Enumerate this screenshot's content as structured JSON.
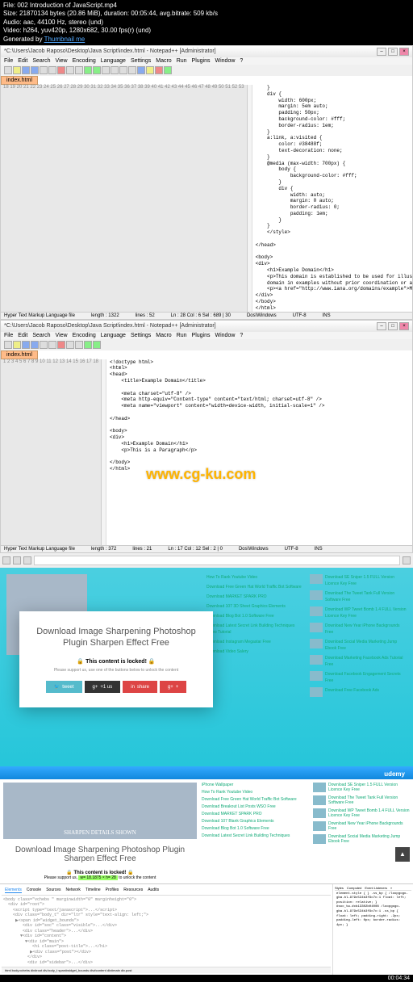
{
  "meta": {
    "file": "File: 002 Introduction of JavaScript.mp4",
    "size": "Size: 21870134 bytes (20.86 MiB), duration: 00:05:44, avg.bitrate: 509 kb/s",
    "audio": "Audio: aac, 44100 Hz, stereo (und)",
    "video": "Video: h264, yuv420p, 1280x682, 30.00 fps(r) (und)",
    "gen": "Generated by ",
    "gen_link": "Thumbnail me"
  },
  "npp1": {
    "title": "*C:\\Users\\Jacob Raposo\\Desktop\\Java Script\\index.html - Notepad++ [Administrator]",
    "menu": [
      "File",
      "Edit",
      "Search",
      "View",
      "Encoding",
      "Language",
      "Settings",
      "Macro",
      "Run",
      "Plugins",
      "Window",
      "?"
    ],
    "tab": "index.html",
    "status": {
      "type": "Hyper Text Markup Language file",
      "length": "length : 1322",
      "lines": "lines : 52",
      "pos": "Ln : 28   Col : 6   Sel : 689 | 30",
      "enc": "Dos\\Windows",
      "enc2": "UTF-8",
      "ins": "INS"
    },
    "code_lines": [
      "    }",
      "    div {",
      "        width: 600px;",
      "        margin: 5em auto;",
      "        padding: 50px;",
      "        background-color: #fff;",
      "        border-radius: 1em;",
      "    }",
      "    a:link, a:visited {",
      "        color: #38488f;",
      "        text-decoration: none;",
      "    }",
      "    @media (max-width: 700px) {",
      "        body {",
      "            background-color: #fff;",
      "        }",
      "        div {",
      "            width: auto;",
      "            margin: 0 auto;",
      "            border-radius: 0;",
      "            padding: 1em;",
      "        }",
      "    }",
      "    </style>",
      "",
      "</head>",
      "",
      "<body>",
      "<div>",
      "    <h1>Example Domain</h1>",
      "    <p>This domain is established to be used for illustrative examples in documents. You may use this",
      "    domain in examples without prior coordination or asking for permission.</p>",
      "    <p><a href=\"http://www.iana.org/domains/example\">More information...</a></p>",
      "</div>",
      "</body>",
      "</html>"
    ]
  },
  "npp2": {
    "title": "*C:\\Users\\Jacob Raposo\\Desktop\\Java Script\\index.html - Notepad++ [Administrator]",
    "tab": "index.html",
    "status": {
      "type": "Hyper Text Markup Language file",
      "length": "length : 372",
      "lines": "lines : 21",
      "pos": "Ln : 17   Col : 12   Sel : 2 | 0",
      "enc": "Dos\\Windows",
      "enc2": "UTF-8",
      "ins": "INS"
    },
    "code_lines": [
      "<!doctype html>",
      "<html>",
      "<head>",
      "    <title>Example Domain</title>",
      "",
      "    <meta charset=\"utf-8\" />",
      "    <meta http-equiv=\"Content-type\" content=\"text/html; charset=utf-8\" />",
      "    <meta name=\"viewport\" content=\"width=device-width, initial-scale=1\" />",
      "",
      "</head>",
      "",
      "<body>",
      "<div>",
      "    <h1>Example Domain</h1>",
      "    <p>This is a Paragraph</p>",
      "",
      "</body>",
      "</html>"
    ]
  },
  "watermark": "www.cg-ku.com",
  "browser": {
    "hero": "SHARPEN DETAILS SHOWN"
  },
  "modal": {
    "title": "Download Image Sharpening Photoshop Plugin Sharpen Effect Free",
    "locked_icon": "🔒",
    "locked": "This content is locked!",
    "sub": "Please support us, use one of the buttons below to unlock the content",
    "btns": {
      "tweet": "tweet",
      "g1": "+1 us",
      "share": "share",
      "g2": "+"
    }
  },
  "sidebar1": [
    {
      "t": "How To Rank Youtube Video"
    },
    {
      "t": "Download Free Green Hat World Traffic Bot Software"
    },
    {
      "t": "Download MARKET SPARK PRO"
    },
    {
      "t": "Download 107 3D Sheet Graphics Elements"
    },
    {
      "t": "Download Blog Bot 1.0 Software Free"
    },
    {
      "t": "Download Latest Secret Link Building Techniques Video Tutorial"
    },
    {
      "t": "Download Instagram Megastar Free"
    },
    {
      "t": "Download Video Salery"
    }
  ],
  "sidebar1b": [
    {
      "t": "Download SE Sniper 1.5 FULL Version Licence Key Free"
    },
    {
      "t": "Download The Tweet Tank Full Version Software Free"
    },
    {
      "t": "Download WP Tweet Bomb 1.4 FULL Version Licence Key Free"
    },
    {
      "t": "Download New Year iPhone Backgrounds Free"
    },
    {
      "t": "Download Social Media Marketing Jump Ebook Free"
    },
    {
      "t": "Download Marketing Facebook Ads Tutorial Free"
    },
    {
      "t": "Download Facebook Engagement Secrets Free"
    },
    {
      "t": "Download Free Facebook Ads"
    }
  ],
  "udemy": "udemy",
  "page2": {
    "hero": "SHARPEN DETAILS SHOWN",
    "title": "Download Image Sharpening Photoshop Plugin Sharpen Effect Free",
    "locked": "🔒 This content is locked! 🔒",
    "sub_pre": "Please support us,",
    "sub_hl": "w= 18.1875 × h= 28",
    "sub_post": "to unlock the content"
  },
  "sidebar2": [
    {
      "t": "iPhone Wallpaper"
    },
    {
      "t": "How To Rank Youtube Video"
    },
    {
      "t": "Download Free Green Hat World Traffic Bot Software"
    },
    {
      "t": "Download Breakout List Posts WSO Free"
    },
    {
      "t": "Download MARKET SPARK PRO"
    },
    {
      "t": "Download 107 Blank Graphics Elements"
    },
    {
      "t": "Download Blog Bot 1.0 Software Free"
    },
    {
      "t": "Download Latest Secret Link Building Techniques"
    }
  ],
  "sidebar2b": [
    {
      "t": "Download SE Sniper 1.5 FULL Version Licence Key Free"
    },
    {
      "t": "Download The Tweet Tank Full Version Software Free"
    },
    {
      "t": "Download WP Tweet Bomb 1.4 FULL Version Licence Key Free"
    },
    {
      "t": "Download New Year iPhone Backgrounds Free"
    },
    {
      "t": "Download Social Media Marketing Jump Ebook Free"
    }
  ],
  "devtools": {
    "tabs": [
      "Elements",
      "Console",
      "Sources",
      "Network",
      "Timeline",
      "Profiles",
      "Resources",
      "Audits"
    ],
    "dom": "<body class=\"vchebs \" marginwidth=\"0\" marginheight=\"0\">\n  <div id=\"root\">\n    <script type=\"text/javascript\">...</script>\n    <div class=\"body_t\" dir=\"ltr\" style=\"text-align: left;\">\n     ▶<span id=\"widget_bounds\">\n        <div id=\"soc\" class=\"visible\">...</div>\n        <div class=\"header\">...</div>\n       ▼<div id=\"content\">\n         ▼<div id=\"main\">\n            <h1 class=\"post-title\">...</h1>\n           ▶<div class=\"post\"></div>\n          </div>\n          <div id=\"sidebar\">...</div>",
    "breadcrumb": "html  body.vchebs  div#root  div.body_t  span#widget_bounds  div#content  div#main  div.post",
    "right_tabs": [
      "Styles",
      "Computed",
      "Event Listeners",
      "»"
    ],
    "styles": "element.style {\n}\n.ss_bp {    /loopgogo-gba.bl…979c534b3f9c7c:1\n  float: left;\n  position: relative;\n}\n#soc_tw.#cb13302b04008   /loopgogo-gba.bl…979c534b3f9c7c:1\n.ss_bp {\n  float: left;\n  padding-right: -2px;\n  padding-left: 0px;\n  border-radius: 4px;\n}"
  },
  "timecode": "00:04:34"
}
